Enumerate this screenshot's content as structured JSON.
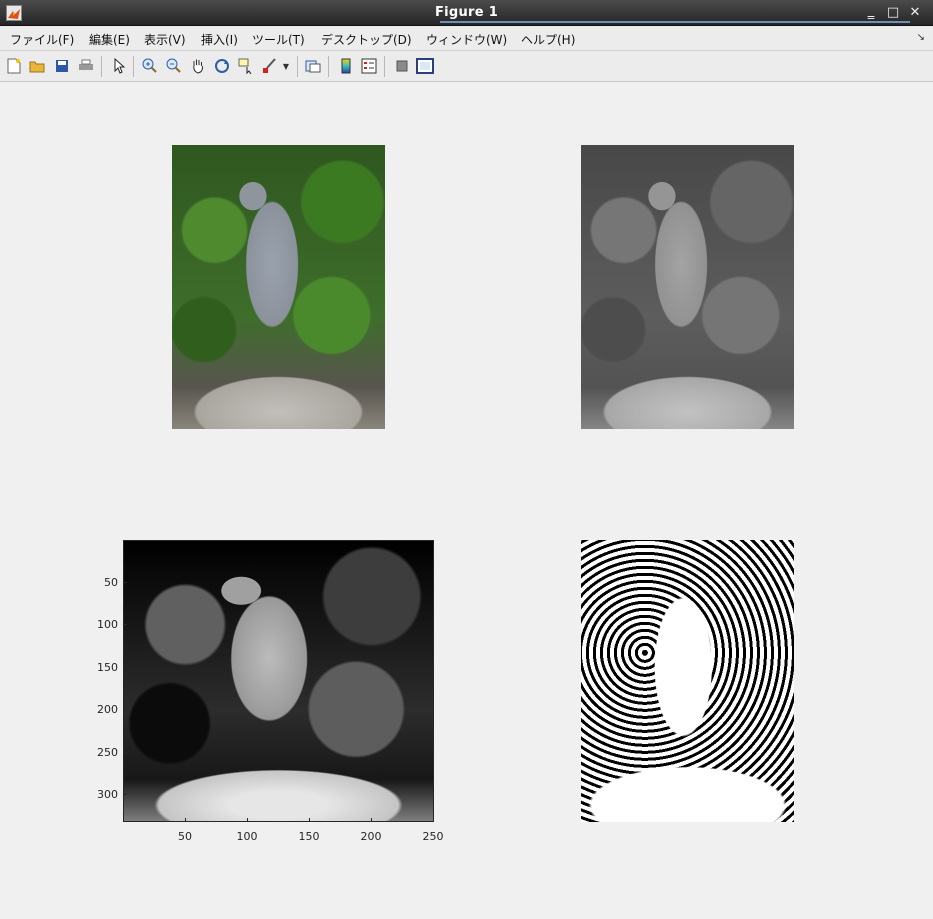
{
  "window": {
    "title": "Figure 1"
  },
  "window_controls": {
    "minimize": "‗",
    "maximize": "□",
    "close": "✕"
  },
  "menu": [
    "ファイル(F)",
    "編集(E)",
    "表示(V)",
    "挿入(I)",
    "ツール(T)",
    "デスクトップ(D)",
    "ウィンドウ(W)",
    "ヘルプ(H)"
  ],
  "menu_corner": "↘",
  "toolbar_icons": [
    "new-figure-icon",
    "open-file-icon",
    "save-icon",
    "print-icon",
    "edit-plot-arrow-icon",
    "zoom-in-icon",
    "zoom-out-icon",
    "pan-hand-icon",
    "rotate-3d-icon",
    "data-cursor-icon",
    "brush-icon",
    "brush-dropdown-icon",
    "link-plot-icon",
    "insert-colorbar-icon",
    "insert-legend-icon",
    "hide-plot-tools-icon",
    "show-plot-tools-icon"
  ],
  "axes_bottom_left": {
    "y_ticks": [
      "50",
      "100",
      "150",
      "200",
      "250",
      "300"
    ],
    "x_ticks": [
      "50",
      "100",
      "150",
      "200",
      "250"
    ]
  }
}
